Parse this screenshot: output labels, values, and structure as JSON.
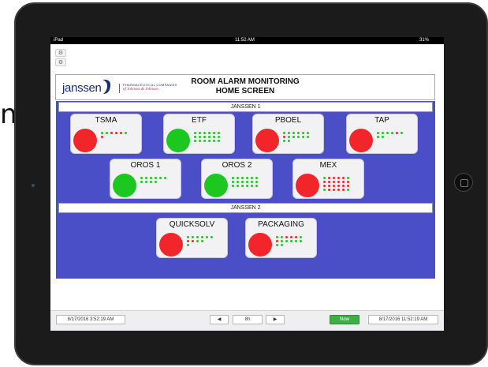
{
  "status_bar": {
    "carrier": "iPad",
    "time": "11:52 AM",
    "battery": "31%"
  },
  "side_buttons": [
    "⚙",
    "⚙"
  ],
  "header": {
    "logo_text": "janssen",
    "logo_sub1": "PHARMACEUTICAL COMPANIES",
    "logo_sub2": "of Johnson & Johnson",
    "title_line1": "ROOM ALARM MONITORING",
    "title_line2": "HOME SCREEN"
  },
  "sections": [
    {
      "label": "JANSSEN 1"
    },
    {
      "label": "JANSSEN 2"
    }
  ],
  "rooms": [
    {
      "name": "TSMA",
      "status": "red",
      "dots": [
        [
          "g",
          "g",
          "r",
          "r",
          "r",
          "g"
        ],
        [
          "r"
        ]
      ]
    },
    {
      "name": "ETF",
      "status": "green",
      "dots": [
        [
          "g",
          "g",
          "g",
          "g",
          "g",
          "g"
        ],
        [
          "g",
          "g",
          "g",
          "g",
          "g",
          "g"
        ],
        [
          "g",
          "g",
          "g",
          "g",
          "g",
          "g"
        ]
      ]
    },
    {
      "name": "PBOEL",
      "status": "red",
      "dots": [
        [
          "g",
          "g",
          "g",
          "g",
          "g",
          "g"
        ],
        [
          "r",
          "g",
          "g",
          "g",
          "g",
          "g"
        ],
        [
          "g",
          "g"
        ]
      ]
    },
    {
      "name": "TAP",
      "status": "red",
      "dots": [
        [
          "g",
          "g",
          "g",
          "g",
          "r",
          "g"
        ],
        [
          "g",
          "g"
        ]
      ]
    },
    {
      "name": "OROS 1",
      "status": "green",
      "dots": [
        [
          "g",
          "g",
          "g",
          "g",
          "g",
          "g"
        ],
        [
          "g",
          "g",
          "g",
          "g"
        ]
      ]
    },
    {
      "name": "OROS 2",
      "status": "green",
      "dots": [
        [
          "g",
          "g",
          "g",
          "g",
          "g",
          "g"
        ],
        [
          "g",
          "g",
          "g",
          "g",
          "g",
          "g"
        ],
        [
          "g",
          "g",
          "g",
          "g",
          "g",
          "g"
        ]
      ]
    },
    {
      "name": "MEX",
      "status": "red",
      "dots": [
        [
          "g",
          "r",
          "r",
          "r",
          "r",
          "g"
        ],
        [
          "r",
          "r",
          "r",
          "r",
          "r",
          "r"
        ],
        [
          "r",
          "r",
          "r",
          "r",
          "r",
          "r"
        ],
        [
          "g",
          "r",
          "r",
          "r",
          "r",
          "g"
        ]
      ]
    },
    {
      "name": "QUICKSOLV",
      "status": "red",
      "dots": [
        [
          "g",
          "g",
          "g",
          "g",
          "g",
          "g"
        ],
        [
          "r",
          "r",
          "g",
          "g"
        ],
        [
          "g"
        ]
      ]
    },
    {
      "name": "PACKAGING",
      "status": "red",
      "dots": [
        [
          "g",
          "g",
          "r",
          "r",
          "r",
          "g"
        ],
        [
          "r",
          "g",
          "g",
          "g",
          "g",
          "g"
        ],
        [
          "g",
          "g"
        ]
      ]
    }
  ],
  "footer": {
    "start_time": "8/17/2016 3:52:19 AM",
    "prev_label": "◀",
    "range_label": "8h",
    "next_label": "▶",
    "now_label": "Now",
    "end_time": "8/17/2016 11:52:19 AM"
  },
  "colors": {
    "alarm_red": "#f2262a",
    "ok_green": "#1cc820",
    "panel_blue": "#4a4fc8"
  }
}
